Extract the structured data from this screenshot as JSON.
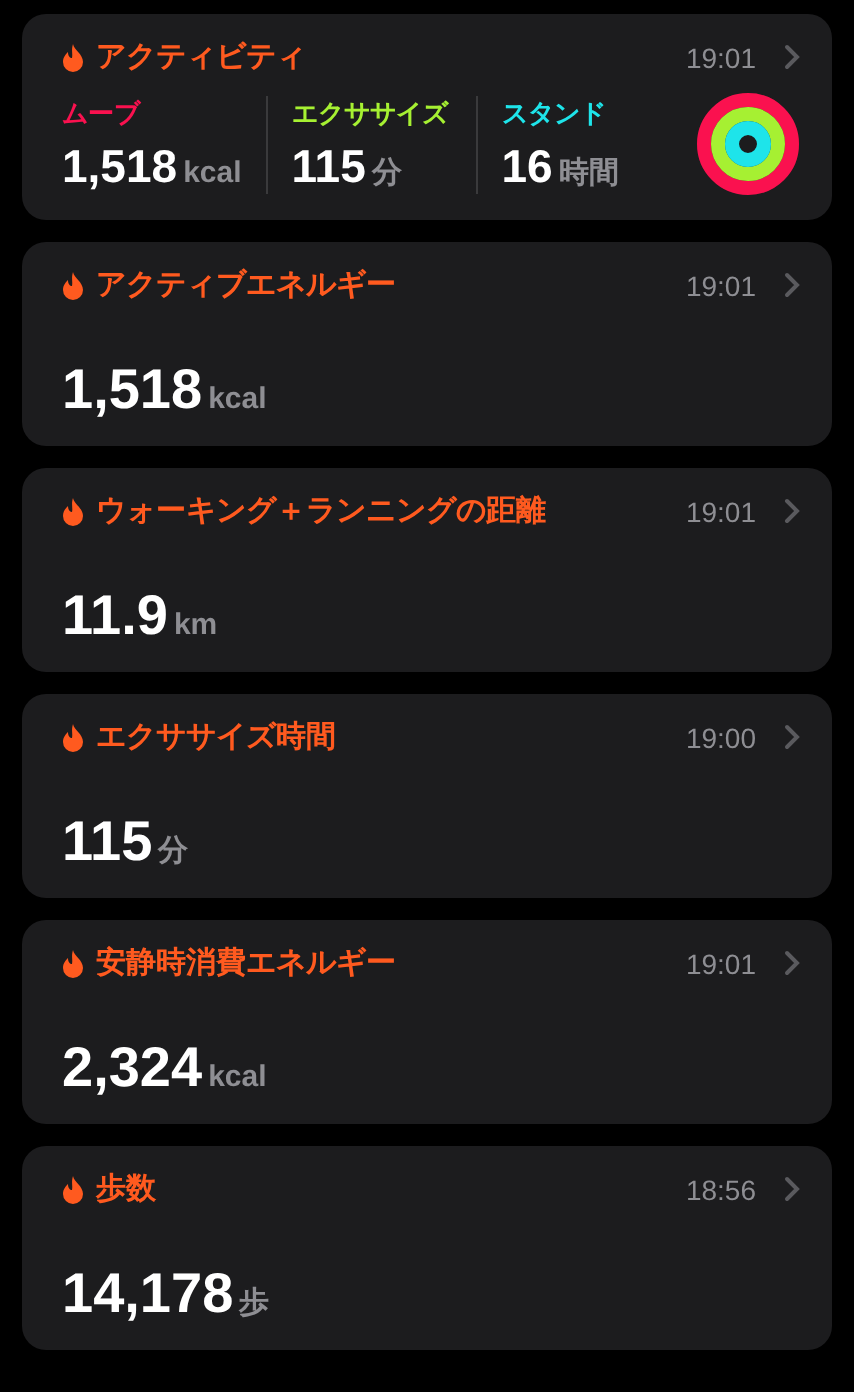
{
  "activity": {
    "title": "アクティビティ",
    "time": "19:01",
    "metrics": [
      {
        "label": "ムーブ",
        "value": "1,518",
        "unit": "kcal",
        "color": "#fa114f",
        "level": 1
      },
      {
        "label": "エクササイズ",
        "value": "115",
        "unit": "分",
        "color": "#a6f032",
        "level": 1
      },
      {
        "label": "スタンド",
        "value": "16",
        "unit": "時間",
        "color": "#1ee4ea",
        "level": 1
      }
    ]
  },
  "cards": [
    {
      "title": "アクティブエネルギー",
      "time": "19:01",
      "value": "1,518",
      "unit": "kcal"
    },
    {
      "title": "ウォーキング＋ランニングの距離",
      "time": "19:01",
      "value": "11.9",
      "unit": "km"
    },
    {
      "title": "エクササイズ時間",
      "time": "19:00",
      "value": "115",
      "unit": "分"
    },
    {
      "title": "安静時消費エネルギー",
      "time": "19:01",
      "value": "2,324",
      "unit": "kcal"
    },
    {
      "title": "歩数",
      "time": "18:56",
      "value": "14,178",
      "unit": "歩"
    }
  ]
}
